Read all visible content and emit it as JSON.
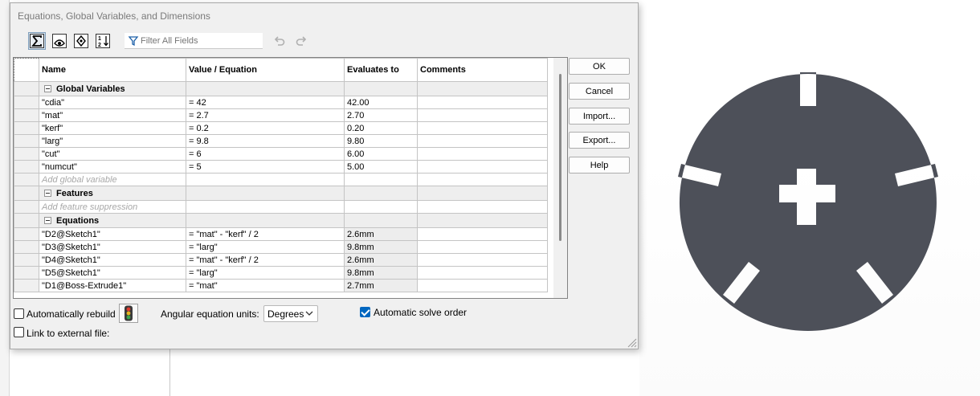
{
  "dialog": {
    "title": "Equations, Global Variables, and Dimensions"
  },
  "toolbar": {
    "buttons": [
      {
        "icon": "sum-icon",
        "active": true
      },
      {
        "icon": "eye-view-icon",
        "active": false
      },
      {
        "icon": "dimension-view-icon",
        "active": false
      },
      {
        "icon": "sort-order-icon",
        "active": false
      }
    ],
    "filter_placeholder": "Filter All Fields",
    "undo_icon": "undo-icon",
    "redo_icon": "redo-icon"
  },
  "table": {
    "columns": [
      "Name",
      "Value / Equation",
      "Evaluates to",
      "Comments"
    ],
    "sections": [
      {
        "title": "Global Variables",
        "rows": [
          {
            "name": "\"cdia\"",
            "value": "= 42",
            "evaluates": "42.00",
            "comment": ""
          },
          {
            "name": "\"mat\"",
            "value": "= 2.7",
            "evaluates": "2.70",
            "comment": ""
          },
          {
            "name": "\"kerf\"",
            "value": "= 0.2",
            "evaluates": "0.20",
            "comment": ""
          },
          {
            "name": "\"larg\"",
            "value": "= 9.8",
            "evaluates": "9.80",
            "comment": ""
          },
          {
            "name": "\"cut\"",
            "value": "= 6",
            "evaluates": "6.00",
            "comment": ""
          },
          {
            "name": "\"numcut\"",
            "value": "= 5",
            "evaluates": "5.00",
            "comment": ""
          }
        ],
        "add_label": "Add global variable"
      },
      {
        "title": "Features",
        "rows": [],
        "add_label": "Add feature suppression"
      },
      {
        "title": "Equations",
        "rows": [
          {
            "name": "\"D2@Sketch1\"",
            "value": "= \"mat\" - \"kerf\" / 2",
            "evaluates": "2.6mm",
            "comment": ""
          },
          {
            "name": "\"D3@Sketch1\"",
            "value": "= \"larg\"",
            "evaluates": "9.8mm",
            "comment": ""
          },
          {
            "name": "\"D4@Sketch1\"",
            "value": "= \"mat\" - \"kerf\" / 2",
            "evaluates": "2.6mm",
            "comment": ""
          },
          {
            "name": "\"D5@Sketch1\"",
            "value": "= \"larg\"",
            "evaluates": "9.8mm",
            "comment": ""
          },
          {
            "name": "\"D1@Boss-Extrude1\"",
            "value": "= \"mat\"",
            "evaluates": "2.7mm",
            "comment": ""
          }
        ]
      }
    ]
  },
  "buttons": {
    "ok": "OK",
    "cancel": "Cancel",
    "import": "Import...",
    "export": "Export...",
    "help": "Help"
  },
  "options": {
    "auto_rebuild_label": "Automatically rebuild",
    "auto_rebuild_checked": false,
    "rebuild_icon": "traffic-light-icon",
    "link_external_label": "Link to external file:",
    "link_external_checked": false,
    "angular_units_label": "Angular equation units:",
    "angular_units_value": "Degrees",
    "auto_solve_label": "Automatic solve order",
    "auto_solve_checked": true
  },
  "viewport": {
    "part_color": "#4d5059",
    "part_icon": "circular-part-with-cross-cutout"
  }
}
